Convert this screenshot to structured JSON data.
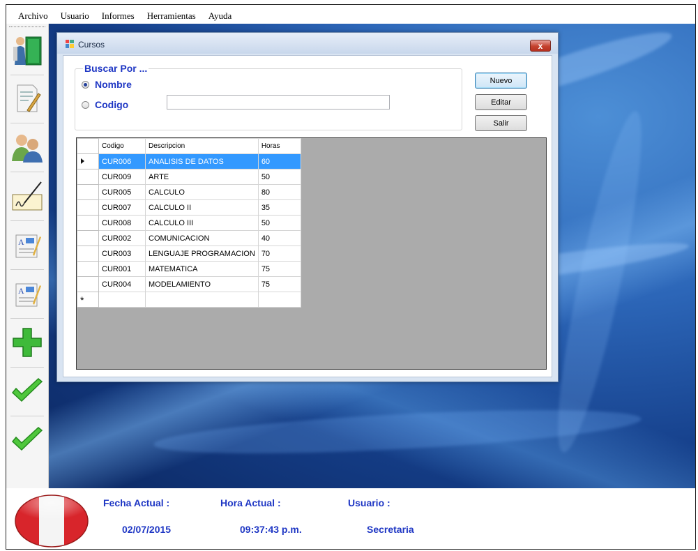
{
  "menu": [
    "Archivo",
    "Usuario",
    "Informes",
    "Herramientas",
    "Ayuda"
  ],
  "toolbar_icons": [
    "book-door-icon",
    "edit-document-icon",
    "users-icon",
    "signature-icon",
    "report-icon",
    "report-icon",
    "add-icon",
    "check-icon",
    "check-icon"
  ],
  "dialog": {
    "title": "Cursos",
    "close_label": "x",
    "search": {
      "legend": "Buscar Por ...",
      "option_nombre": "Nombre",
      "option_codigo": "Codigo",
      "selected": "Nombre",
      "value": ""
    },
    "buttons": {
      "nuevo": "Nuevo",
      "editar": "Editar",
      "salir": "Salir"
    },
    "grid": {
      "columns": [
        "Codigo",
        "Descripcion",
        "Horas"
      ],
      "rows": [
        {
          "codigo": "CUR006",
          "descripcion": "ANALISIS DE DATOS",
          "horas": "60"
        },
        {
          "codigo": "CUR009",
          "descripcion": "ARTE",
          "horas": "50"
        },
        {
          "codigo": "CUR005",
          "descripcion": "CALCULO",
          "horas": "80"
        },
        {
          "codigo": "CUR007",
          "descripcion": "CALCULO II",
          "horas": "35"
        },
        {
          "codigo": "CUR008",
          "descripcion": "CALCULO III",
          "horas": "50"
        },
        {
          "codigo": "CUR002",
          "descripcion": "COMUNICACION",
          "horas": "40"
        },
        {
          "codigo": "CUR003",
          "descripcion": "LENGUAJE PROGRAMACION",
          "horas": "70"
        },
        {
          "codigo": "CUR001",
          "descripcion": "MATEMATICA",
          "horas": "75"
        },
        {
          "codigo": "CUR004",
          "descripcion": "MODELAMIENTO",
          "horas": "75"
        }
      ],
      "new_row_marker": "*"
    }
  },
  "status": {
    "fecha_label": "Fecha Actual :",
    "fecha_value": "02/07/2015",
    "hora_label": "Hora Actual :",
    "hora_value": "09:37:43 p.m.",
    "usuario_label": "Usuario :",
    "usuario_value": "Secretaria"
  },
  "colors": {
    "label_blue": "#1f37c4",
    "selection": "#3399ff",
    "flag_red": "#d8252b"
  }
}
